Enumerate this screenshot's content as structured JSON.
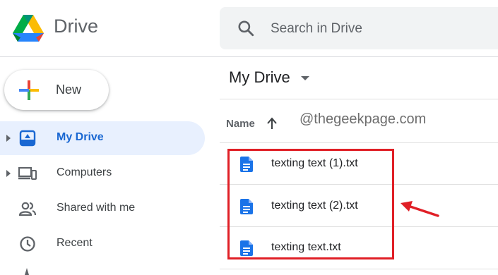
{
  "header": {
    "app_name": "Drive",
    "search": {
      "placeholder": "Search in Drive",
      "value": ""
    }
  },
  "new_button": {
    "label": "New"
  },
  "sidebar": {
    "items": [
      {
        "label": "My Drive",
        "icon": "my-drive-icon",
        "active": true,
        "expandable": true
      },
      {
        "label": "Computers",
        "icon": "computers-icon",
        "active": false,
        "expandable": true
      },
      {
        "label": "Shared with me",
        "icon": "shared-with-me-icon",
        "active": false,
        "expandable": false
      },
      {
        "label": "Recent",
        "icon": "recent-clock-icon",
        "active": false,
        "expandable": false
      }
    ]
  },
  "main": {
    "title": "My Drive",
    "columns": {
      "name": "Name",
      "sort": "ascending"
    },
    "watermark": "@thegeekpage.com",
    "files": [
      {
        "name": "texting text (1).txt",
        "icon": "docs-file-icon"
      },
      {
        "name": "texting text (2).txt",
        "icon": "docs-file-icon"
      },
      {
        "name": "texting text.txt",
        "icon": "docs-file-icon"
      }
    ]
  },
  "colors": {
    "accent_blue": "#1a73e8",
    "active_bg": "#e8f0fe",
    "active_text": "#1967d2",
    "annotation_red": "#e01f26",
    "search_bg": "#f1f3f4"
  }
}
